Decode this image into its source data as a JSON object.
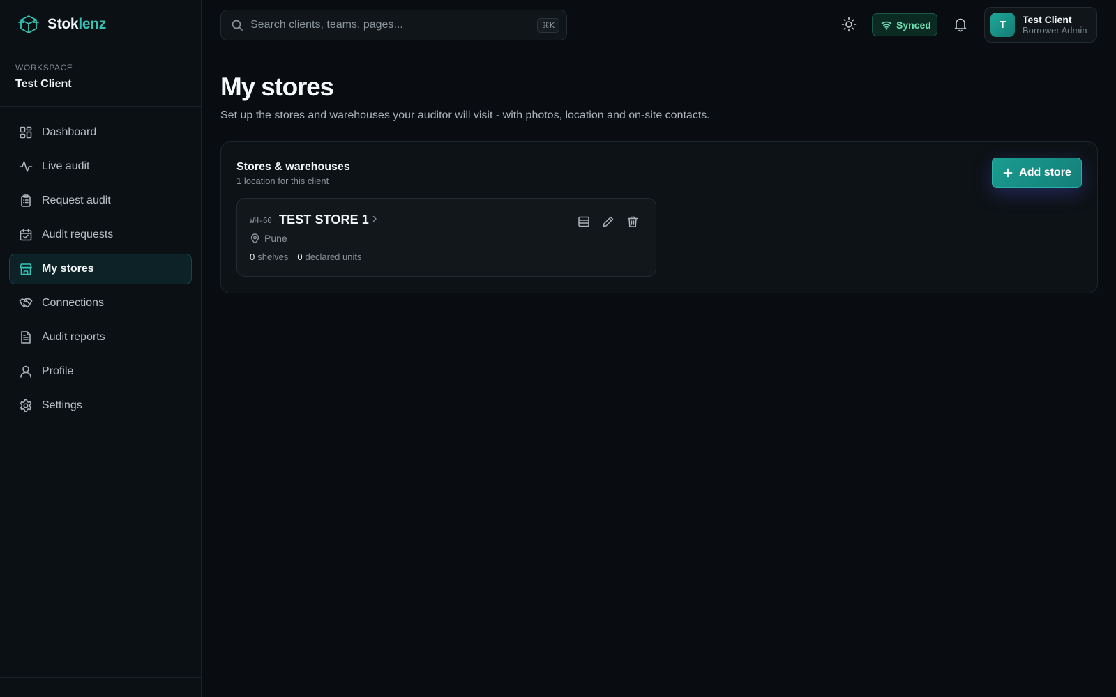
{
  "brand": {
    "name_primary": "Stok",
    "name_accent": "lenz",
    "accent_color": "#34c3b3"
  },
  "workspace": {
    "label": "Workspace",
    "name": "Test Client"
  },
  "sidebar": {
    "items": [
      {
        "label": "Dashboard",
        "icon": "dashboard-icon"
      },
      {
        "label": "Live audit",
        "icon": "activity-icon"
      },
      {
        "label": "Request audit",
        "icon": "clipboard-icon"
      },
      {
        "label": "Audit requests",
        "icon": "calendar-check-icon"
      },
      {
        "label": "My stores",
        "icon": "store-icon",
        "active": true
      },
      {
        "label": "Connections",
        "icon": "handshake-icon"
      },
      {
        "label": "Audit reports",
        "icon": "file-text-icon"
      },
      {
        "label": "Profile",
        "icon": "user-icon"
      },
      {
        "label": "Settings",
        "icon": "gear-icon"
      }
    ]
  },
  "topbar": {
    "search_placeholder": "Search clients, teams, pages...",
    "search_shortcut": "⌘K",
    "sync_status": "Synced",
    "user": {
      "initial": "T",
      "name": "Test Client",
      "role": "Borrower Admin"
    }
  },
  "main": {
    "title": "My stores",
    "subtitle": "Set up the stores and warehouses your auditor will visit - with photos, location and on-site contacts.",
    "panel": {
      "title": "Stores & warehouses",
      "subtitle": "1 location for this client",
      "add_button": "Add store"
    },
    "stores": [
      {
        "code": "WH-60",
        "name": "TEST STORE 1",
        "location": "Pune",
        "shelves": "0",
        "shelves_label": "shelves",
        "units": "0",
        "units_label": "declared units"
      }
    ]
  }
}
